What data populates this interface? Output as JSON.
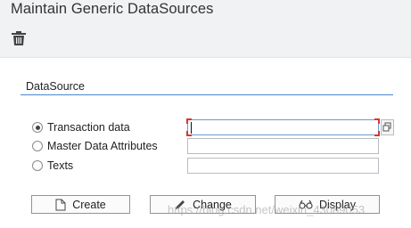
{
  "window": {
    "title": "Maintain Generic DataSources"
  },
  "toolbar": {
    "delete_icon": "trash-icon"
  },
  "groupbox": {
    "title": "DataSource",
    "options": [
      {
        "label": "Transaction data",
        "selected": true
      },
      {
        "label": "Master Data Attributes",
        "selected": false
      },
      {
        "label": "Texts",
        "selected": false
      }
    ],
    "fields": [
      {
        "value": ""
      },
      {
        "value": ""
      },
      {
        "value": ""
      }
    ],
    "buttons": {
      "create": "Create",
      "change": "Change",
      "display": "Display"
    }
  },
  "watermark": "https://blog.csdn.net/weixin_43089053",
  "colors": {
    "header_bg": "#f1f2f3",
    "group_underline": "#4a86c8",
    "focus_marker": "#dd3333"
  }
}
